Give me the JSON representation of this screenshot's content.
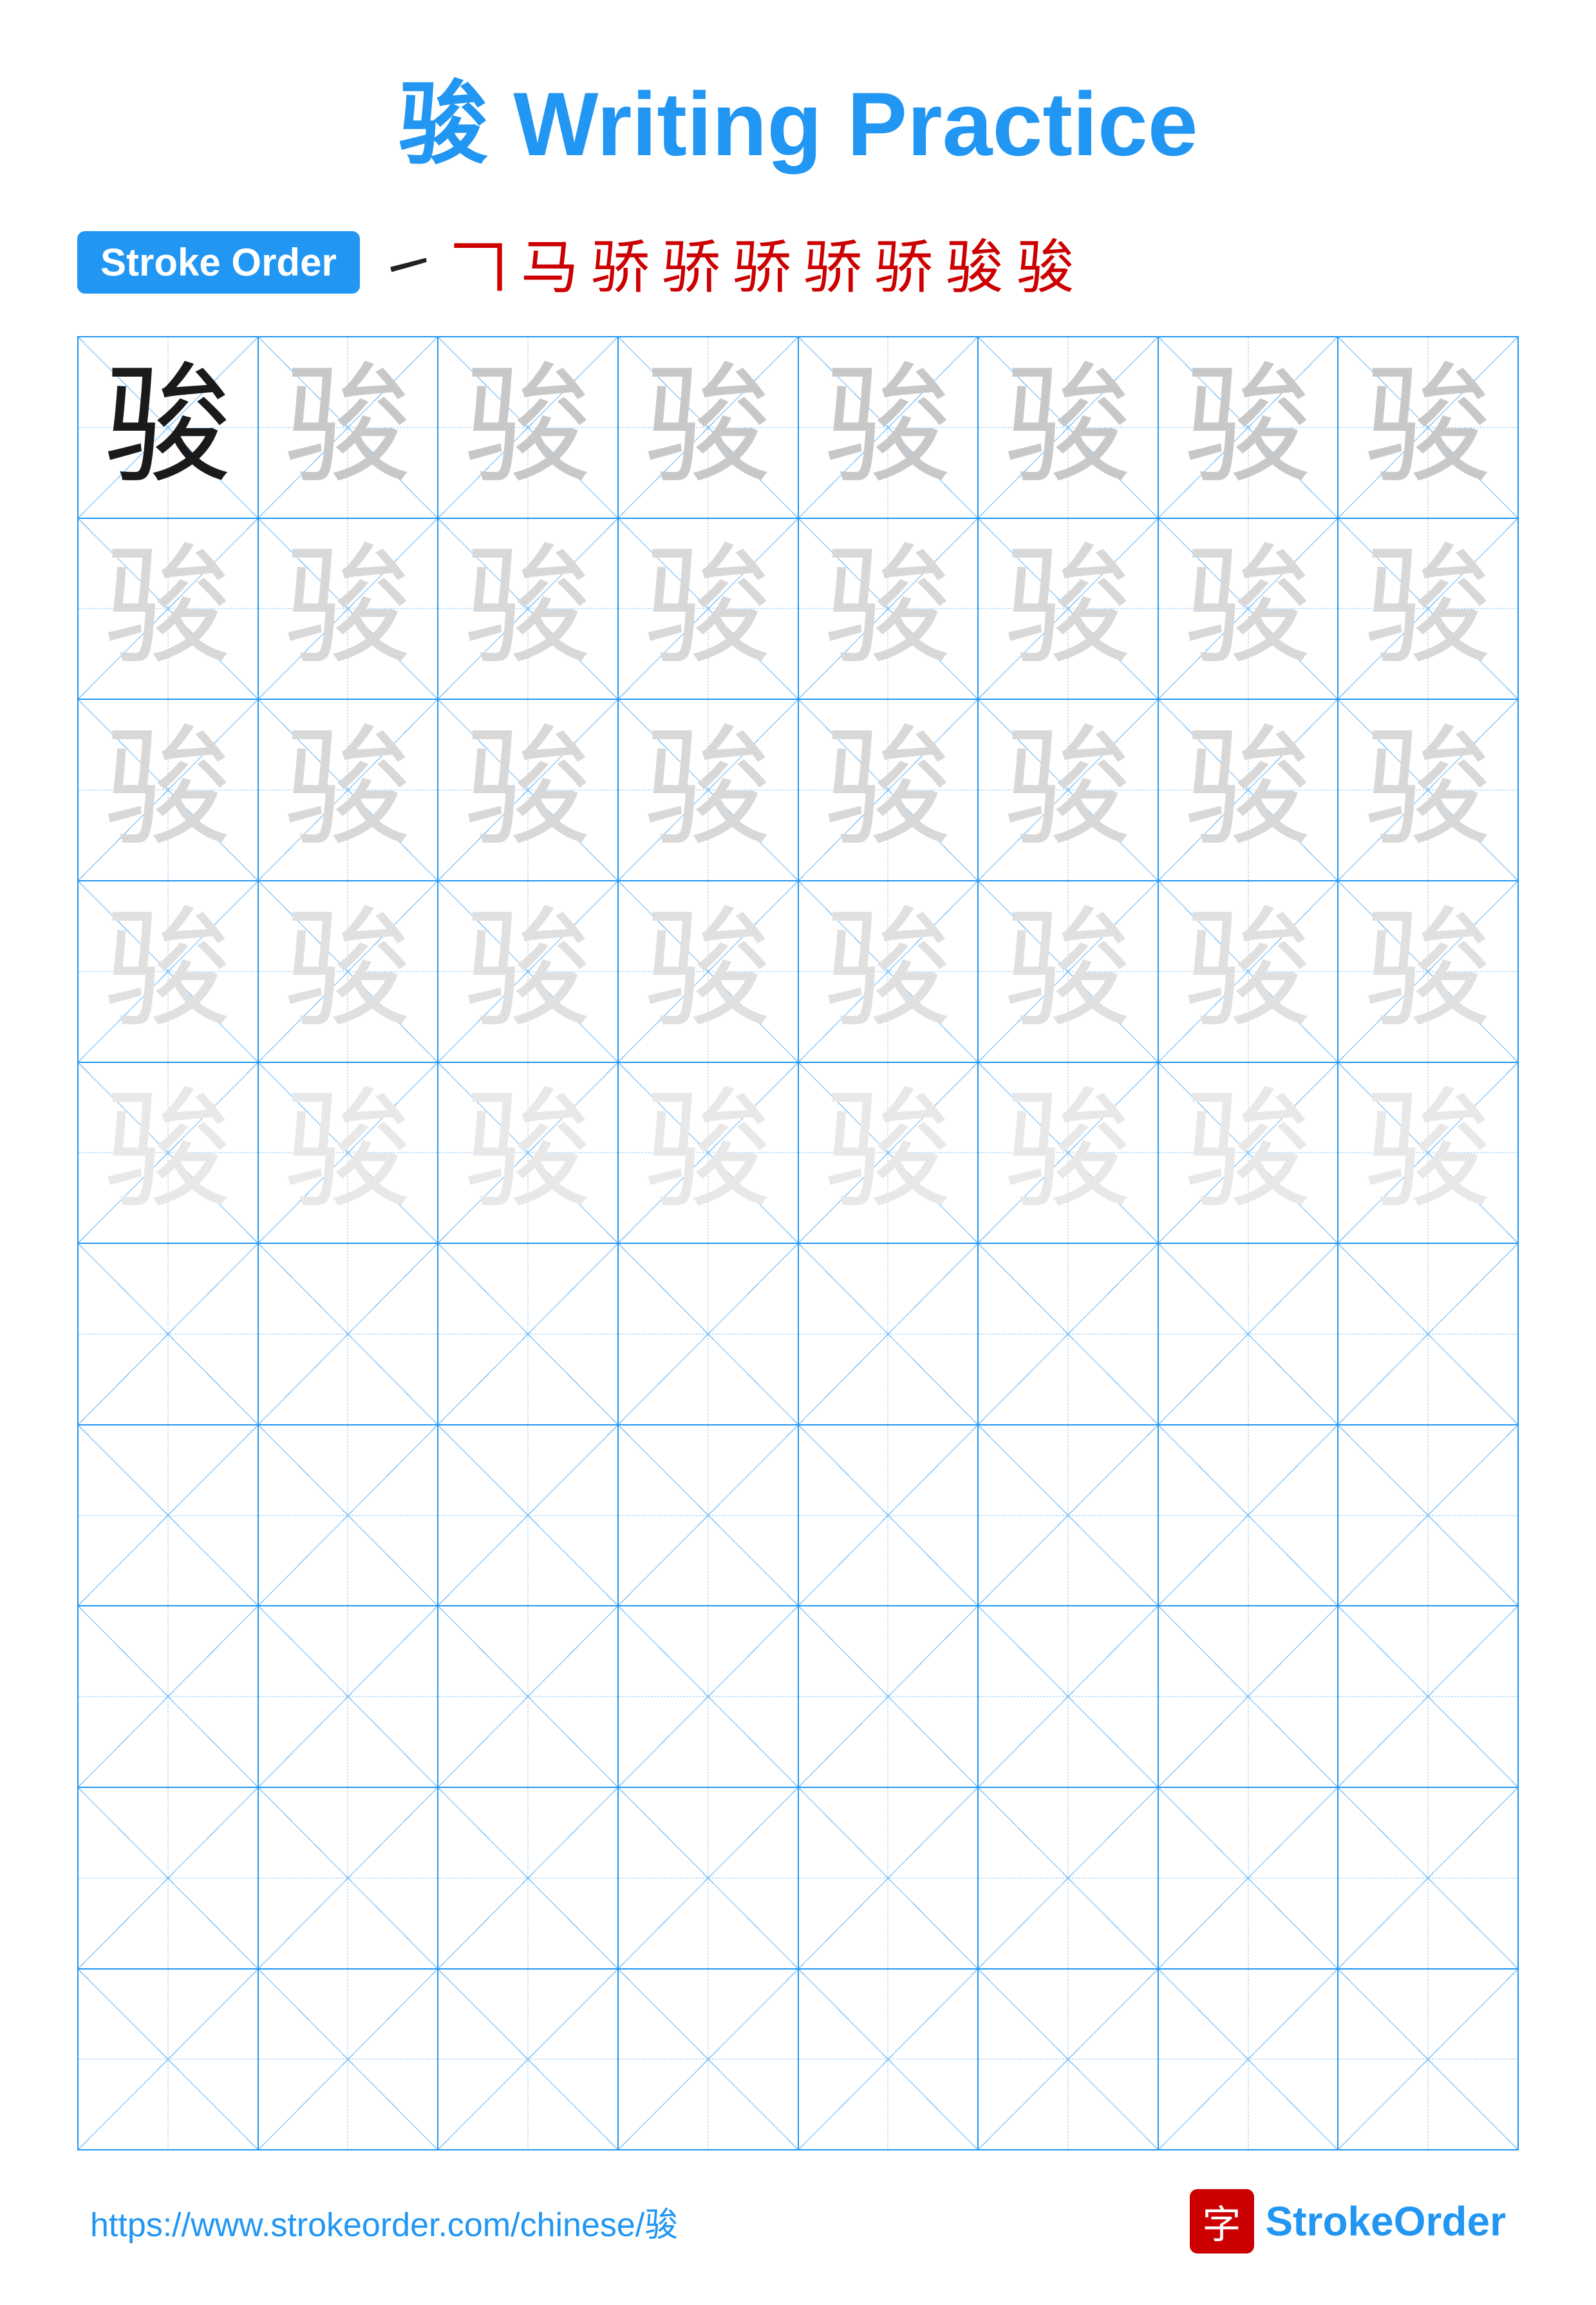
{
  "page": {
    "title": "骏 Writing Practice",
    "title_char": "骏",
    "title_text": " Writing Practice"
  },
  "stroke_order": {
    "badge_label": "Stroke Order",
    "strokes": [
      "㇀",
      "𠃍",
      "马",
      "骄",
      "骄",
      "骄",
      "骄",
      "骄",
      "骏",
      "骏"
    ]
  },
  "grid": {
    "character": "骏",
    "rows": 10,
    "cols": 8,
    "practice_rows": 5,
    "blank_rows": 5
  },
  "footer": {
    "url": "https://www.strokeorder.com/chinese/骏",
    "logo_icon": "字",
    "logo_text": "StrokeOrder"
  }
}
